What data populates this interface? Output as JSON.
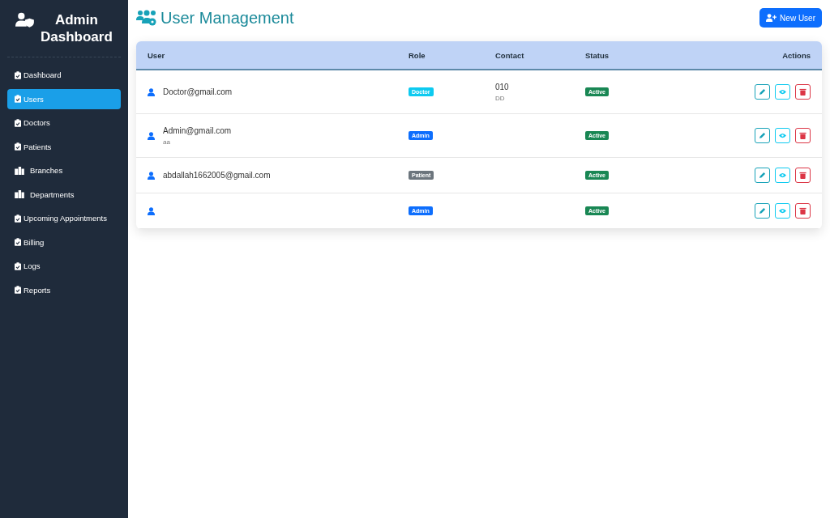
{
  "sidebar": {
    "title": "Admin Dashboard",
    "items": [
      {
        "label": "Dashboard",
        "kind": "clipboard",
        "selected": false
      },
      {
        "label": "Users",
        "kind": "clipboard",
        "selected": true
      },
      {
        "label": "Doctors",
        "kind": "clipboard",
        "selected": false
      },
      {
        "label": "Patients",
        "kind": "clipboard",
        "selected": false
      },
      {
        "label": "Branches",
        "kind": "building",
        "selected": false
      },
      {
        "label": "Departments",
        "kind": "building",
        "selected": false
      },
      {
        "label": "Upcoming Appointments",
        "kind": "clipboard",
        "selected": false
      },
      {
        "label": "Billing",
        "kind": "clipboard",
        "selected": false
      },
      {
        "label": "Logs",
        "kind": "clipboard",
        "selected": false
      },
      {
        "label": "Reports",
        "kind": "clipboard",
        "selected": false
      }
    ]
  },
  "header": {
    "title": "User Management",
    "new_button": "New User"
  },
  "table": {
    "columns": [
      "User",
      "Role",
      "Contact",
      "Status",
      "Actions"
    ],
    "rows": [
      {
        "email": "Doctor@gmail.com",
        "role": "Doctor",
        "color": "#0dcaf0",
        "phone": "010",
        "address": "DD",
        "status": "Active"
      },
      {
        "email": "Admin@gmail.com",
        "name": "aa",
        "role": "Admin",
        "color": "#0d6efd",
        "status": "Active"
      },
      {
        "email": "abdallah1662005@gmail.com",
        "role": "Patient",
        "color": "#6c757d",
        "status": "Active"
      },
      {
        "role": "Admin",
        "color": "#0d6efd",
        "status": "Active"
      }
    ]
  }
}
